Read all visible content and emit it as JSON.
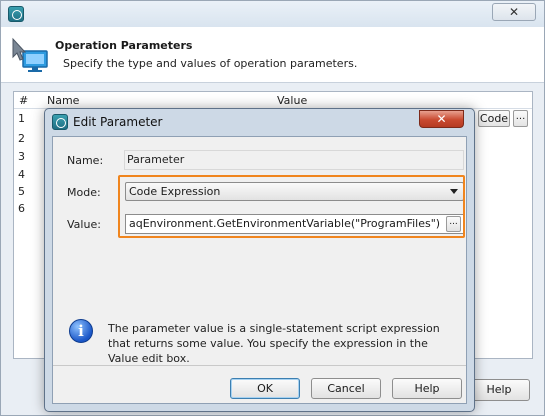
{
  "outer": {
    "header_title": "Operation Parameters",
    "header_subtitle": "Specify the type and values of operation parameters.",
    "close_label": "✕",
    "table": {
      "columns": [
        "#",
        "Name",
        "Value"
      ],
      "rows": [
        "1",
        "2",
        "3",
        "4",
        "5",
        "6"
      ]
    },
    "code_button": "Code",
    "dots_button": "...",
    "help_button": "Help"
  },
  "dialog": {
    "title": "Edit Parameter",
    "close_label": "✕",
    "name_label": "Name:",
    "name_value": "Parameter",
    "mode_label": "Mode:",
    "mode_value": "Code Expression",
    "value_label": "Value:",
    "value_text": "aqEnvironment.GetEnvironmentVariable(\"ProgramFiles\")",
    "value_dots": "...",
    "info_text": "The parameter value is a single-statement script expression that returns some value. You specify the expression in the Value edit box.",
    "ok_label": "OK",
    "cancel_label": "Cancel",
    "help_label": "Help"
  },
  "colors": {
    "highlight": "#f0851e",
    "dialog_frame": "#cdd9e6",
    "close_button": "#c94a30"
  }
}
